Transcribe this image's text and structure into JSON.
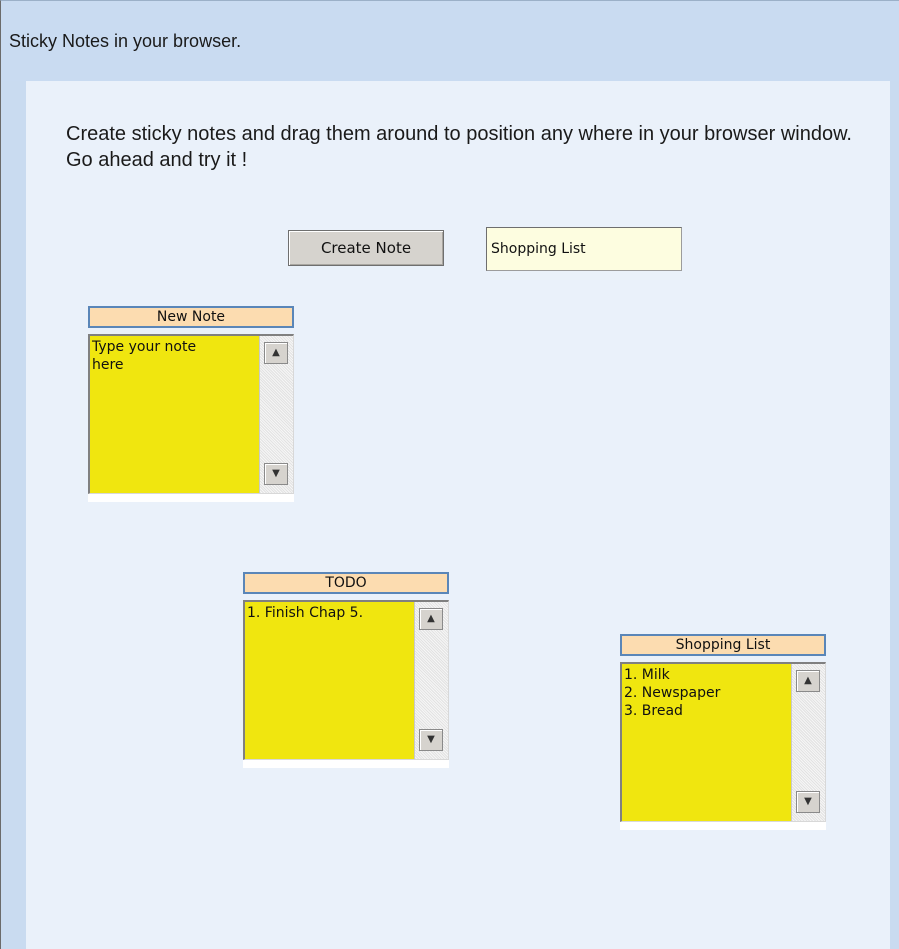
{
  "header": {
    "title": "Sticky Notes in your browser."
  },
  "intro": {
    "text": "Create sticky notes and drag them around to position any where in your browser window. Go ahead and try it !"
  },
  "controls": {
    "create_label": "Create Note",
    "title_value": "Shopping List"
  },
  "notes": [
    {
      "title": "New Note",
      "body": "Type your note\nhere"
    },
    {
      "title": "TODO",
      "body": "1. Finish Chap 5."
    },
    {
      "title": "Shopping List",
      "body": "1. Milk\n2. Newspaper\n3. Bread"
    }
  ],
  "icons": {
    "scroll_up": "▲",
    "scroll_down": "▼"
  },
  "colors": {
    "note_body": "#f0e60f",
    "note_header": "#fcdcb0",
    "header_bg": "#c9dbf1",
    "content_bg": "#eaf1fa"
  }
}
